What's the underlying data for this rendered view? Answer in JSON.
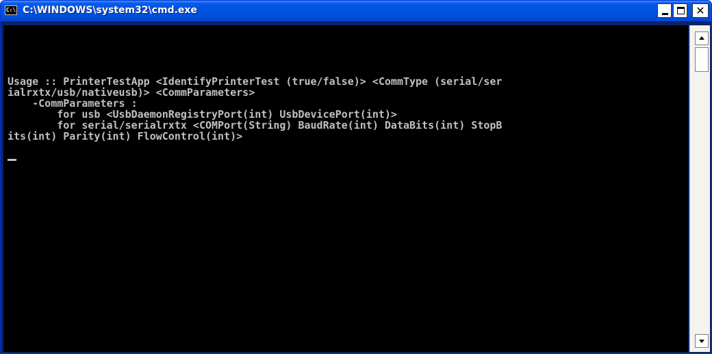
{
  "window": {
    "title": "C:\\WINDOWS\\system32\\cmd.exe",
    "app_icon_text": "C:\\"
  },
  "title_controls": {
    "minimize": "minimize-icon",
    "maximize": "maximize-icon",
    "close": "close-icon",
    "close_glyph": "✕"
  },
  "console": {
    "lines": [
      "Usage :: PrinterTestApp <IdentifyPrinterTest (true/false)> <CommType (serial/ser",
      "ialrxtx/usb/nativeusb)> <CommParameters>",
      "    -CommParameters :",
      "        for usb <UsbDaemonRegistryPort(int) UsbDevicePort(int)>",
      "        for serial/serialrxtx <COMPort(String) BaudRate(int) DataBits(int) StopB",
      "its(int) Parity(int) FlowControl(int)>"
    ]
  },
  "colors": {
    "titlebar": "#0054e3",
    "console_bg": "#000000",
    "console_text": "#c0c0c0"
  }
}
